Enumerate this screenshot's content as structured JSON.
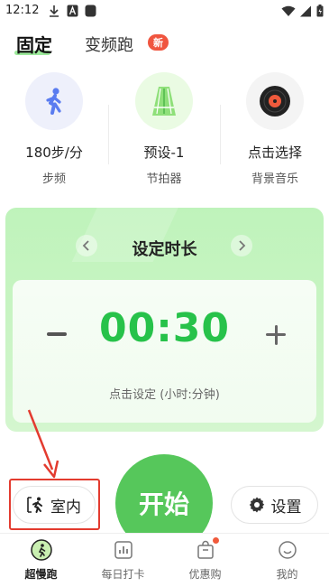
{
  "status_bar": {
    "time": "12:12"
  },
  "tabs": {
    "fixed": "固定",
    "variable": "变频跑",
    "new_badge": "新"
  },
  "options": [
    {
      "value": "180步/分",
      "label": "步频",
      "icon": "walking-person-icon"
    },
    {
      "value": "预设-1",
      "label": "节拍器",
      "icon": "track-icon"
    },
    {
      "value": "点击选择",
      "label": "背景音乐",
      "icon": "vinyl-record-icon"
    }
  ],
  "duration_card": {
    "title": "设定时长",
    "time": "00:30",
    "hint": "点击设定 (小时:分钟)"
  },
  "controls": {
    "indoor": "室内",
    "start": "开始",
    "settings": "设置"
  },
  "nav": [
    {
      "label": "超慢跑",
      "icon": "runner-badge-icon",
      "active": true
    },
    {
      "label": "每日打卡",
      "icon": "chart-icon",
      "active": false
    },
    {
      "label": "优惠购",
      "icon": "shopping-bag-icon",
      "active": false
    },
    {
      "label": "我的",
      "icon": "smiley-icon",
      "active": false
    }
  ],
  "colors": {
    "accent_green": "#27c24a",
    "start_button": "#56c75b",
    "badge_red": "#f0553f",
    "annotation_red": "#e33b2f"
  }
}
